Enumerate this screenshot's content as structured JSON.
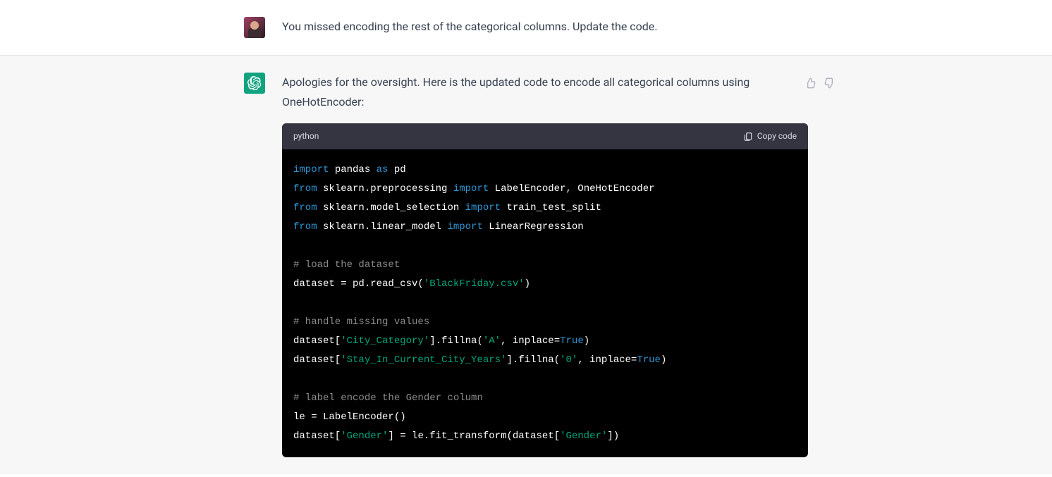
{
  "user_message": "You missed encoding the rest of the categorical columns. Update the code.",
  "assistant_intro": "Apologies for the oversight. Here is the updated code to encode all categorical columns using OneHotEncoder:",
  "code_header": {
    "language": "python",
    "copy_label": "Copy code"
  },
  "code_tokens": [
    [
      {
        "t": "import",
        "c": "kw"
      },
      {
        "t": " pandas ",
        "c": ""
      },
      {
        "t": "as",
        "c": "kw"
      },
      {
        "t": " pd",
        "c": ""
      }
    ],
    [
      {
        "t": "from",
        "c": "kw"
      },
      {
        "t": " sklearn.preprocessing ",
        "c": ""
      },
      {
        "t": "import",
        "c": "kw"
      },
      {
        "t": " LabelEncoder, OneHotEncoder",
        "c": ""
      }
    ],
    [
      {
        "t": "from",
        "c": "kw"
      },
      {
        "t": " sklearn.model_selection ",
        "c": ""
      },
      {
        "t": "import",
        "c": "kw"
      },
      {
        "t": " train_test_split",
        "c": ""
      }
    ],
    [
      {
        "t": "from",
        "c": "kw"
      },
      {
        "t": " sklearn.linear_model ",
        "c": ""
      },
      {
        "t": "import",
        "c": "kw"
      },
      {
        "t": " LinearRegression",
        "c": ""
      }
    ],
    [],
    [
      {
        "t": "# load the dataset",
        "c": "cmt"
      }
    ],
    [
      {
        "t": "dataset = pd.read_csv(",
        "c": ""
      },
      {
        "t": "'BlackFriday.csv'",
        "c": "str"
      },
      {
        "t": ")",
        "c": ""
      }
    ],
    [],
    [
      {
        "t": "# handle missing values",
        "c": "cmt"
      }
    ],
    [
      {
        "t": "dataset[",
        "c": ""
      },
      {
        "t": "'City_Category'",
        "c": "str"
      },
      {
        "t": "].fillna(",
        "c": ""
      },
      {
        "t": "'A'",
        "c": "str"
      },
      {
        "t": ", inplace=",
        "c": ""
      },
      {
        "t": "True",
        "c": "const"
      },
      {
        "t": ")",
        "c": ""
      }
    ],
    [
      {
        "t": "dataset[",
        "c": ""
      },
      {
        "t": "'Stay_In_Current_City_Years'",
        "c": "str"
      },
      {
        "t": "].fillna(",
        "c": ""
      },
      {
        "t": "'0'",
        "c": "str"
      },
      {
        "t": ", inplace=",
        "c": ""
      },
      {
        "t": "True",
        "c": "const"
      },
      {
        "t": ")",
        "c": ""
      }
    ],
    [],
    [
      {
        "t": "# label encode the Gender column",
        "c": "cmt"
      }
    ],
    [
      {
        "t": "le = LabelEncoder()",
        "c": ""
      }
    ],
    [
      {
        "t": "dataset[",
        "c": ""
      },
      {
        "t": "'Gender'",
        "c": "str"
      },
      {
        "t": "] = le.fit_transform(dataset[",
        "c": ""
      },
      {
        "t": "'Gender'",
        "c": "str"
      },
      {
        "t": "])",
        "c": ""
      }
    ]
  ]
}
